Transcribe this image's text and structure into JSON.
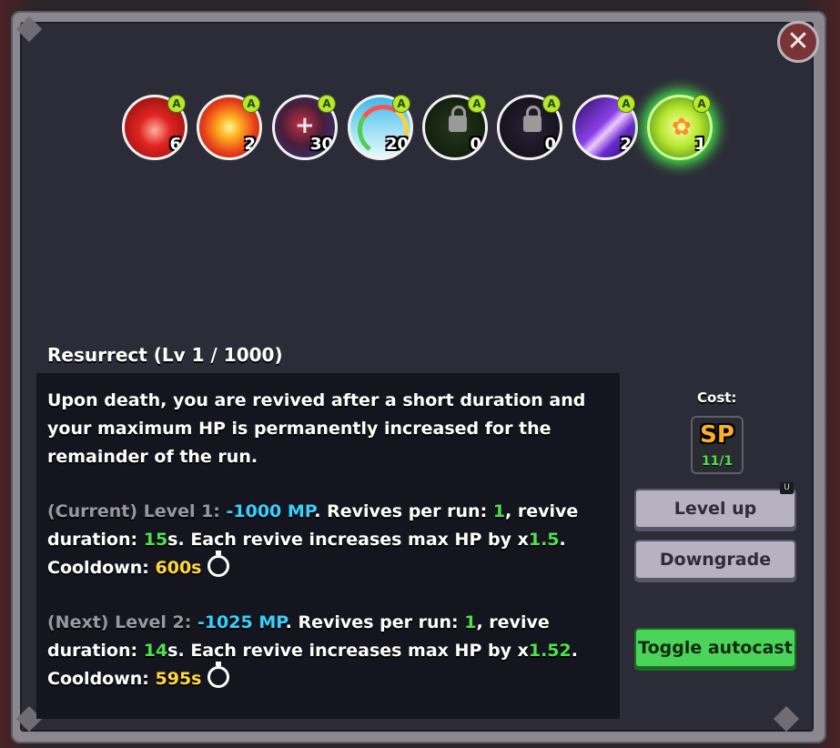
{
  "skills": [
    {
      "name": "mouth-skill-icon",
      "count": "6",
      "badge": "A",
      "color": "#c8201c"
    },
    {
      "name": "explosion-skill-icon",
      "count": "2",
      "badge": "A",
      "color": "#e8501a"
    },
    {
      "name": "heal-swirl-skill-icon",
      "count": "30",
      "badge": "A",
      "color": "#3a2a5a"
    },
    {
      "name": "rainbow-cloud-skill-icon",
      "count": "20",
      "badge": "A",
      "color": "#4fc6e0"
    },
    {
      "name": "locked-skill-icon",
      "count": "0",
      "badge": "A",
      "color": "#1b2a16"
    },
    {
      "name": "locked-skill-icon",
      "count": "0",
      "badge": "A",
      "color": "#1c1826"
    },
    {
      "name": "lightning-skill-icon",
      "count": "2",
      "badge": "A",
      "color": "#7a3ad8"
    },
    {
      "name": "lily-flower-skill-icon",
      "count": "1",
      "badge": "A",
      "color": "#9ad824"
    }
  ],
  "skill_title": "Resurrect (Lv 1 / 1000)",
  "description": "Upon death, you are revived after a short duration and your maximum HP is permanently increased for the remainder of the run.",
  "current": {
    "prefix": "(Current) Level 1: ",
    "mp": "-1000 MP",
    "t1": ". Revives per run: ",
    "revives": "1",
    "t2": ", revive duration: ",
    "duration": "15",
    "t3": "s. Each revive increases max HP by x",
    "mult": "1.5",
    "t4": ".",
    "cooldown_label": "Cooldown: ",
    "cooldown": "600s"
  },
  "next": {
    "prefix": "(Next) Level 2: ",
    "mp": "-1025 MP",
    "t1": ". Revives per run: ",
    "revives": "1",
    "t2": ", revive duration: ",
    "duration": "14",
    "t3": "s. Each revive increases max HP by x",
    "mult": "1.52",
    "t4": ".",
    "cooldown_label": "Cooldown: ",
    "cooldown": "595s"
  },
  "cost": {
    "label": "Cost:",
    "currency": "SP",
    "amount": "11/1"
  },
  "buttons": {
    "level_up": "Level up",
    "level_up_hotkey": "U",
    "downgrade": "Downgrade",
    "toggle_autocast": "Toggle autocast"
  },
  "close_label": "✕"
}
